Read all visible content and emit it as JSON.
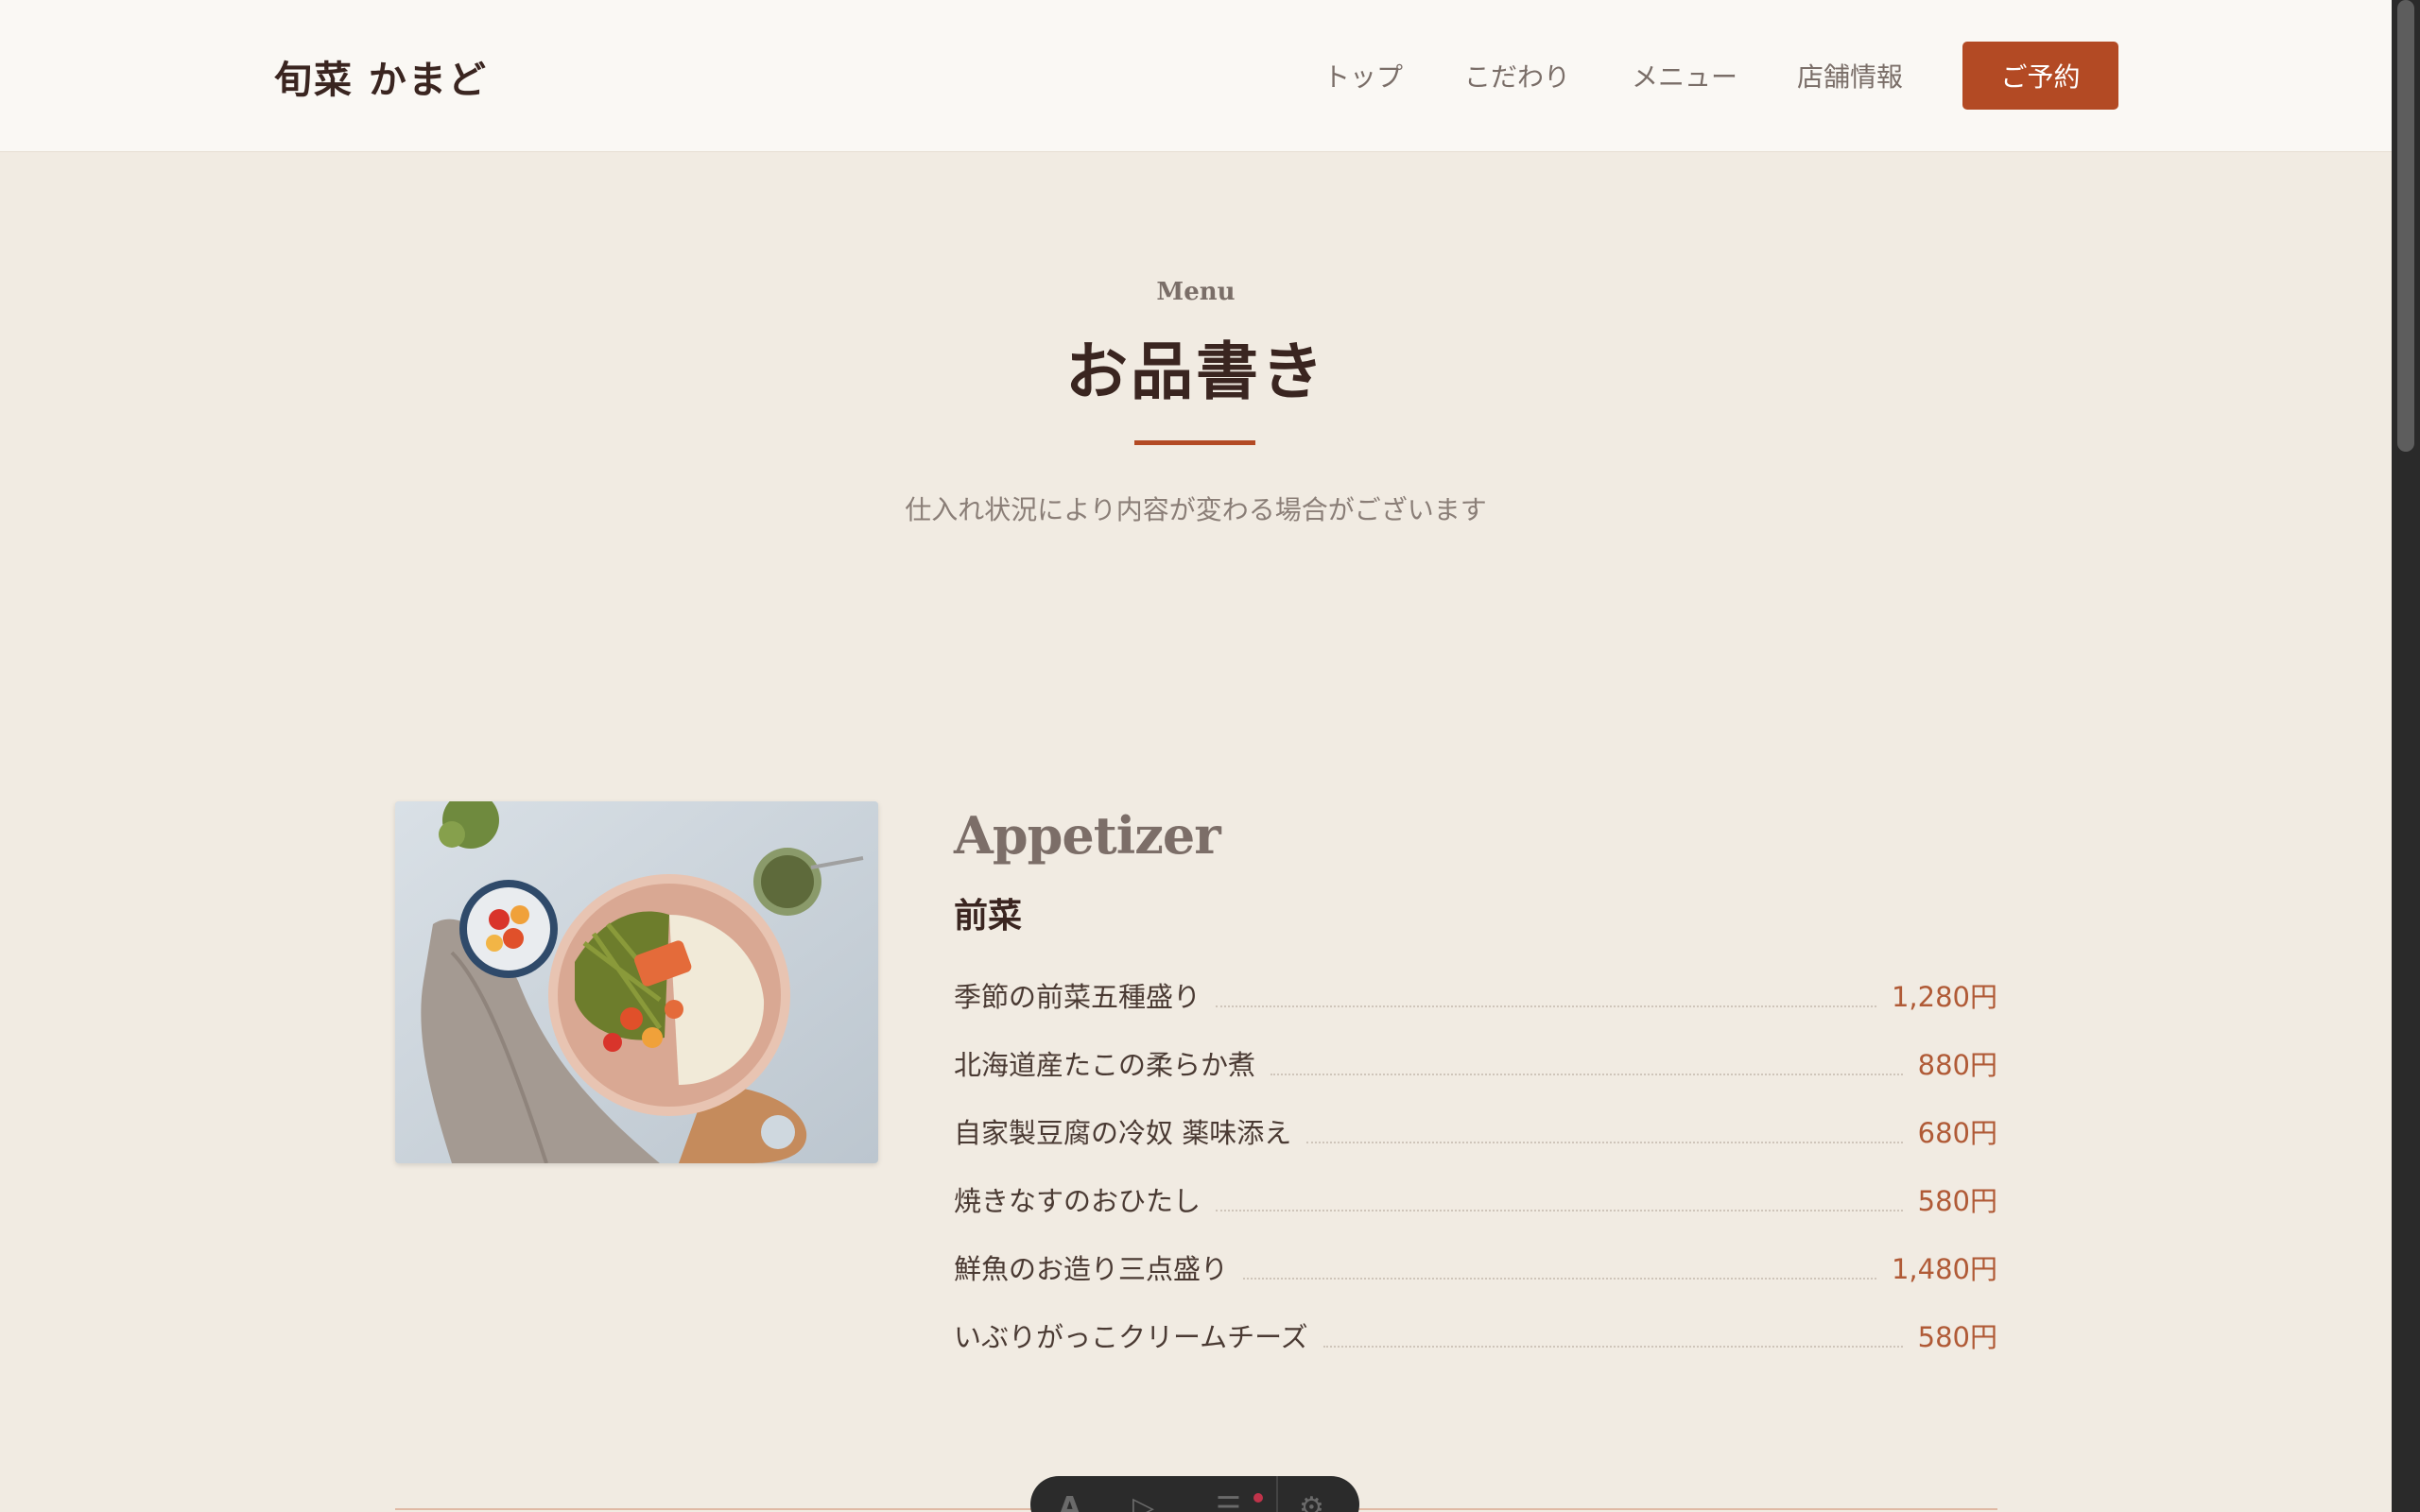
{
  "header": {
    "brand": "旬菜 かまど",
    "nav": [
      "トップ",
      "こだわり",
      "メニュー",
      "店舗情報"
    ],
    "reserve_label": "ご予約"
  },
  "section": {
    "label": "Menu",
    "title": "お品書き",
    "subtitle": "仕入れ状況により内容が変わる場合がございます"
  },
  "category": {
    "name_en": "Appetizer",
    "name_jp": "前菜",
    "items": [
      {
        "name": "季節の前菜五種盛り",
        "price": "1,280円"
      },
      {
        "name": "北海道産たこの柔らか煮",
        "price": "880円"
      },
      {
        "name": "自家製豆腐の冷奴 薬味添え",
        "price": "680円"
      },
      {
        "name": "焼きなすのおひたし",
        "price": "580円"
      },
      {
        "name": "鮮魚のお造り三点盛り",
        "price": "1,480円"
      },
      {
        "name": "いぶりがっこクリームチーズ",
        "price": "580円"
      }
    ]
  },
  "colors": {
    "accent": "#b34a24",
    "background": "#f1ebe2",
    "header_bg": "#faf8f4",
    "price": "#b05a36"
  }
}
